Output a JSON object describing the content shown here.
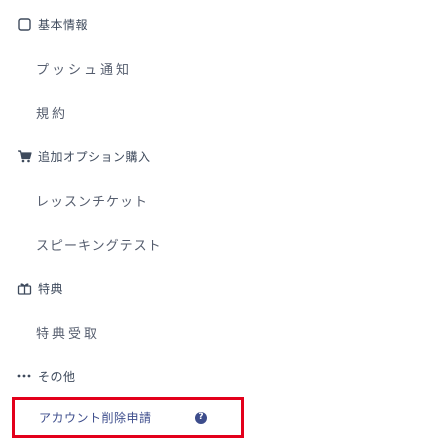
{
  "menu": {
    "sections": [
      {
        "label": "基本情報",
        "icon": "square-outline-icon",
        "items": [
          {
            "label": "プッシュ通知"
          },
          {
            "label": "規約"
          }
        ]
      },
      {
        "label": "追加オプション購入",
        "icon": "cart-icon",
        "items": [
          {
            "label": "レッスンチケット"
          },
          {
            "label": "スピーキングテスト"
          }
        ]
      },
      {
        "label": "特典",
        "icon": "gift-icon",
        "items": [
          {
            "label": "特典受取"
          }
        ]
      },
      {
        "label": "その他",
        "icon": "ellipsis-icon",
        "items": []
      }
    ],
    "highlighted": {
      "label": "アカウント削除申請",
      "help_icon": "question-circle-icon",
      "help_glyph": "?",
      "highlight_color": "#e3001b"
    }
  }
}
